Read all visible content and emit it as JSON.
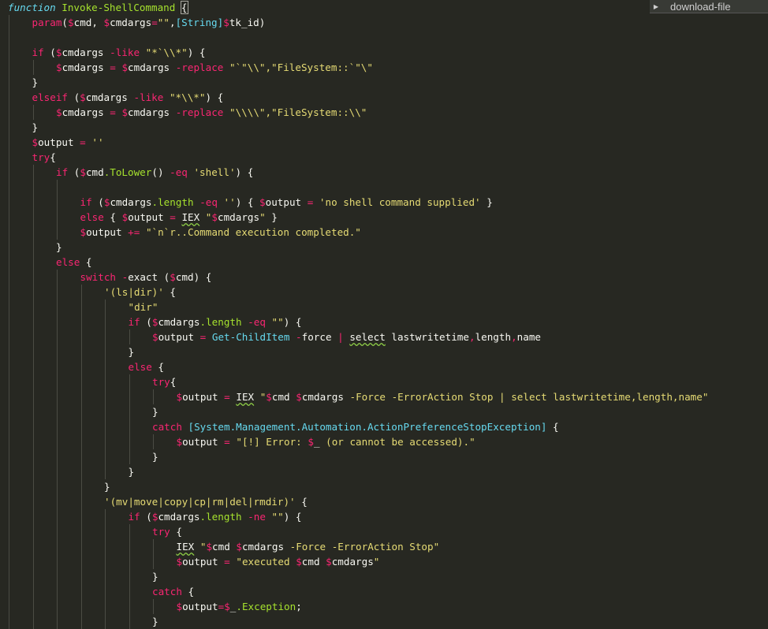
{
  "editor": {
    "theme": {
      "background": "#272822",
      "keyword": "#f92672",
      "function": "#a6e22e",
      "string": "#e6db74",
      "type": "#66d9ef",
      "text": "#f8f8f2",
      "indent_guide": "#4b4c44"
    },
    "code_lines": [
      {
        "indent": 0,
        "tokens": [
          {
            "t": "function",
            "c": "kw-it"
          },
          {
            "t": " ",
            "c": "plain"
          },
          {
            "t": "Invoke-ShellCommand",
            "c": "fn"
          },
          {
            "t": " ",
            "c": "plain"
          },
          {
            "t": "{",
            "c": "plain",
            "hl": true
          }
        ]
      },
      {
        "indent": 1,
        "tokens": [
          {
            "t": "param",
            "c": "kw"
          },
          {
            "t": "(",
            "c": "plain"
          },
          {
            "t": "$",
            "c": "dollar"
          },
          {
            "t": "cmd, ",
            "c": "var"
          },
          {
            "t": "$",
            "c": "dollar"
          },
          {
            "t": "cmdargs",
            "c": "var"
          },
          {
            "t": "=",
            "c": "op"
          },
          {
            "t": "\"\"",
            "c": "str"
          },
          {
            "t": ",",
            "c": "plain"
          },
          {
            "t": "[String]",
            "c": "type"
          },
          {
            "t": "$",
            "c": "dollar"
          },
          {
            "t": "tk_id)",
            "c": "var"
          }
        ]
      },
      {
        "indent": 1,
        "tokens": []
      },
      {
        "indent": 1,
        "tokens": [
          {
            "t": "if",
            "c": "kw"
          },
          {
            "t": " (",
            "c": "plain"
          },
          {
            "t": "$",
            "c": "dollar"
          },
          {
            "t": "cmdargs ",
            "c": "var"
          },
          {
            "t": "-like",
            "c": "op"
          },
          {
            "t": " ",
            "c": "plain"
          },
          {
            "t": "\"*`\\\\*\"",
            "c": "str"
          },
          {
            "t": ") {",
            "c": "plain"
          }
        ]
      },
      {
        "indent": 2,
        "tokens": [
          {
            "t": "$",
            "c": "dollar"
          },
          {
            "t": "cmdargs ",
            "c": "var"
          },
          {
            "t": "=",
            "c": "op"
          },
          {
            "t": " ",
            "c": "plain"
          },
          {
            "t": "$",
            "c": "dollar"
          },
          {
            "t": "cmdargs ",
            "c": "var"
          },
          {
            "t": "-replace",
            "c": "op"
          },
          {
            "t": " ",
            "c": "plain"
          },
          {
            "t": "\"`\"\\\\\",\"FileSystem::`\"\\\"",
            "c": "str"
          }
        ]
      },
      {
        "indent": 1,
        "tokens": [
          {
            "t": "}",
            "c": "plain"
          }
        ]
      },
      {
        "indent": 1,
        "tokens": [
          {
            "t": "elseif",
            "c": "kw"
          },
          {
            "t": " (",
            "c": "plain"
          },
          {
            "t": "$",
            "c": "dollar"
          },
          {
            "t": "cmdargs ",
            "c": "var"
          },
          {
            "t": "-like",
            "c": "op"
          },
          {
            "t": " ",
            "c": "plain"
          },
          {
            "t": "\"*\\\\*\"",
            "c": "str"
          },
          {
            "t": ") {",
            "c": "plain"
          }
        ]
      },
      {
        "indent": 2,
        "tokens": [
          {
            "t": "$",
            "c": "dollar"
          },
          {
            "t": "cmdargs ",
            "c": "var"
          },
          {
            "t": "=",
            "c": "op"
          },
          {
            "t": " ",
            "c": "plain"
          },
          {
            "t": "$",
            "c": "dollar"
          },
          {
            "t": "cmdargs ",
            "c": "var"
          },
          {
            "t": "-replace",
            "c": "op"
          },
          {
            "t": " ",
            "c": "plain"
          },
          {
            "t": "\"\\\\\\\\\",\"FileSystem::\\\\\"",
            "c": "str"
          }
        ]
      },
      {
        "indent": 1,
        "tokens": [
          {
            "t": "}",
            "c": "plain"
          }
        ]
      },
      {
        "indent": 1,
        "tokens": [
          {
            "t": "$",
            "c": "dollar"
          },
          {
            "t": "output ",
            "c": "var"
          },
          {
            "t": "=",
            "c": "op"
          },
          {
            "t": " ",
            "c": "plain"
          },
          {
            "t": "''",
            "c": "str"
          }
        ]
      },
      {
        "indent": 1,
        "tokens": [
          {
            "t": "try",
            "c": "kw"
          },
          {
            "t": "{",
            "c": "plain"
          }
        ]
      },
      {
        "indent": 2,
        "tokens": [
          {
            "t": "if",
            "c": "kw"
          },
          {
            "t": " (",
            "c": "plain"
          },
          {
            "t": "$",
            "c": "dollar"
          },
          {
            "t": "cmd",
            "c": "var"
          },
          {
            "t": ".ToLower",
            "c": "fn"
          },
          {
            "t": "() ",
            "c": "plain"
          },
          {
            "t": "-eq",
            "c": "op"
          },
          {
            "t": " ",
            "c": "plain"
          },
          {
            "t": "'shell'",
            "c": "str"
          },
          {
            "t": ") {",
            "c": "plain"
          }
        ]
      },
      {
        "indent": 3,
        "tokens": []
      },
      {
        "indent": 3,
        "tokens": [
          {
            "t": "if",
            "c": "kw"
          },
          {
            "t": " (",
            "c": "plain"
          },
          {
            "t": "$",
            "c": "dollar"
          },
          {
            "t": "cmdargs",
            "c": "var"
          },
          {
            "t": ".length",
            "c": "fn"
          },
          {
            "t": " ",
            "c": "plain"
          },
          {
            "t": "-eq",
            "c": "op"
          },
          {
            "t": " ",
            "c": "plain"
          },
          {
            "t": "''",
            "c": "str"
          },
          {
            "t": ") { ",
            "c": "plain"
          },
          {
            "t": "$",
            "c": "dollar"
          },
          {
            "t": "output ",
            "c": "var"
          },
          {
            "t": "=",
            "c": "op"
          },
          {
            "t": " ",
            "c": "plain"
          },
          {
            "t": "'no shell command supplied'",
            "c": "str"
          },
          {
            "t": " }",
            "c": "plain"
          }
        ]
      },
      {
        "indent": 3,
        "tokens": [
          {
            "t": "else",
            "c": "kw"
          },
          {
            "t": " { ",
            "c": "plain"
          },
          {
            "t": "$",
            "c": "dollar"
          },
          {
            "t": "output ",
            "c": "var"
          },
          {
            "t": "=",
            "c": "op"
          },
          {
            "t": " ",
            "c": "plain"
          },
          {
            "t": "IEX",
            "c": "plain",
            "sq": true
          },
          {
            "t": " ",
            "c": "plain"
          },
          {
            "t": "\"",
            "c": "str"
          },
          {
            "t": "$",
            "c": "dollar"
          },
          {
            "t": "cmdargs",
            "c": "var"
          },
          {
            "t": "\"",
            "c": "str"
          },
          {
            "t": " }",
            "c": "plain"
          }
        ]
      },
      {
        "indent": 3,
        "tokens": [
          {
            "t": "$",
            "c": "dollar"
          },
          {
            "t": "output ",
            "c": "var"
          },
          {
            "t": "+=",
            "c": "op"
          },
          {
            "t": " ",
            "c": "plain"
          },
          {
            "t": "\"`n`r..Command execution completed.\"",
            "c": "str"
          }
        ]
      },
      {
        "indent": 2,
        "tokens": [
          {
            "t": "}",
            "c": "plain"
          }
        ]
      },
      {
        "indent": 2,
        "tokens": [
          {
            "t": "else",
            "c": "kw"
          },
          {
            "t": " {",
            "c": "plain"
          }
        ]
      },
      {
        "indent": 3,
        "tokens": [
          {
            "t": "switch",
            "c": "kw"
          },
          {
            "t": " ",
            "c": "plain"
          },
          {
            "t": "-",
            "c": "op"
          },
          {
            "t": "exact (",
            "c": "plain"
          },
          {
            "t": "$",
            "c": "dollar"
          },
          {
            "t": "cmd) {",
            "c": "var"
          }
        ]
      },
      {
        "indent": 4,
        "tokens": [
          {
            "t": "'(ls|dir)'",
            "c": "str"
          },
          {
            "t": " {",
            "c": "plain"
          }
        ]
      },
      {
        "indent": 5,
        "tokens": [
          {
            "t": "\"dir\"",
            "c": "str"
          }
        ]
      },
      {
        "indent": 5,
        "tokens": [
          {
            "t": "if",
            "c": "kw"
          },
          {
            "t": " (",
            "c": "plain"
          },
          {
            "t": "$",
            "c": "dollar"
          },
          {
            "t": "cmdargs",
            "c": "var"
          },
          {
            "t": ".length",
            "c": "fn"
          },
          {
            "t": " ",
            "c": "plain"
          },
          {
            "t": "-eq",
            "c": "op"
          },
          {
            "t": " ",
            "c": "plain"
          },
          {
            "t": "\"\"",
            "c": "str"
          },
          {
            "t": ") {",
            "c": "plain"
          }
        ]
      },
      {
        "indent": 6,
        "tokens": [
          {
            "t": "$",
            "c": "dollar"
          },
          {
            "t": "output ",
            "c": "var"
          },
          {
            "t": "=",
            "c": "op"
          },
          {
            "t": " ",
            "c": "plain"
          },
          {
            "t": "Get-ChildItem",
            "c": "type"
          },
          {
            "t": " ",
            "c": "plain"
          },
          {
            "t": "-",
            "c": "op"
          },
          {
            "t": "force ",
            "c": "plain"
          },
          {
            "t": "|",
            "c": "op"
          },
          {
            "t": " ",
            "c": "plain"
          },
          {
            "t": "select",
            "c": "plain",
            "sq": true
          },
          {
            "t": " lastwritetime",
            "c": "plain"
          },
          {
            "t": ",",
            "c": "op"
          },
          {
            "t": "length",
            "c": "plain"
          },
          {
            "t": ",",
            "c": "op"
          },
          {
            "t": "name",
            "c": "plain"
          }
        ]
      },
      {
        "indent": 5,
        "tokens": [
          {
            "t": "}",
            "c": "plain"
          }
        ]
      },
      {
        "indent": 5,
        "tokens": [
          {
            "t": "else",
            "c": "kw"
          },
          {
            "t": " {",
            "c": "plain"
          }
        ]
      },
      {
        "indent": 6,
        "tokens": [
          {
            "t": "try",
            "c": "kw"
          },
          {
            "t": "{",
            "c": "plain"
          }
        ]
      },
      {
        "indent": 7,
        "tokens": [
          {
            "t": "$",
            "c": "dollar"
          },
          {
            "t": "output ",
            "c": "var"
          },
          {
            "t": "=",
            "c": "op"
          },
          {
            "t": " ",
            "c": "plain"
          },
          {
            "t": "IEX",
            "c": "plain",
            "sq": true
          },
          {
            "t": " ",
            "c": "plain"
          },
          {
            "t": "\"",
            "c": "str"
          },
          {
            "t": "$",
            "c": "dollar"
          },
          {
            "t": "cmd ",
            "c": "var"
          },
          {
            "t": "$",
            "c": "dollar"
          },
          {
            "t": "cmdargs",
            "c": "var"
          },
          {
            "t": " -Force -ErrorAction Stop | select lastwritetime,length,name\"",
            "c": "str"
          }
        ]
      },
      {
        "indent": 6,
        "tokens": [
          {
            "t": "}",
            "c": "plain"
          }
        ]
      },
      {
        "indent": 6,
        "tokens": [
          {
            "t": "catch",
            "c": "kw"
          },
          {
            "t": " ",
            "c": "plain"
          },
          {
            "t": "[System.Management.Automation.ActionPreferenceStopException]",
            "c": "type"
          },
          {
            "t": " {",
            "c": "plain"
          }
        ]
      },
      {
        "indent": 7,
        "tokens": [
          {
            "t": "$",
            "c": "dollar"
          },
          {
            "t": "output ",
            "c": "var"
          },
          {
            "t": "=",
            "c": "op"
          },
          {
            "t": " ",
            "c": "plain"
          },
          {
            "t": "\"[!] Error: ",
            "c": "str"
          },
          {
            "t": "$",
            "c": "dollar"
          },
          {
            "t": "_",
            "c": "var"
          },
          {
            "t": " (or cannot be accessed).\"",
            "c": "str"
          }
        ]
      },
      {
        "indent": 6,
        "tokens": [
          {
            "t": "}",
            "c": "plain"
          }
        ]
      },
      {
        "indent": 5,
        "tokens": [
          {
            "t": "}",
            "c": "plain"
          }
        ]
      },
      {
        "indent": 4,
        "tokens": [
          {
            "t": "}",
            "c": "plain"
          }
        ]
      },
      {
        "indent": 4,
        "tokens": [
          {
            "t": "'(mv|move|copy|cp|rm|del|rmdir)'",
            "c": "str"
          },
          {
            "t": " {",
            "c": "plain"
          }
        ]
      },
      {
        "indent": 5,
        "tokens": [
          {
            "t": "if",
            "c": "kw"
          },
          {
            "t": " (",
            "c": "plain"
          },
          {
            "t": "$",
            "c": "dollar"
          },
          {
            "t": "cmdargs",
            "c": "var"
          },
          {
            "t": ".length",
            "c": "fn"
          },
          {
            "t": " ",
            "c": "plain"
          },
          {
            "t": "-ne",
            "c": "op"
          },
          {
            "t": " ",
            "c": "plain"
          },
          {
            "t": "\"\"",
            "c": "str"
          },
          {
            "t": ") {",
            "c": "plain"
          }
        ]
      },
      {
        "indent": 6,
        "tokens": [
          {
            "t": "try",
            "c": "kw"
          },
          {
            "t": " {",
            "c": "plain"
          }
        ]
      },
      {
        "indent": 7,
        "tokens": [
          {
            "t": "IEX",
            "c": "plain",
            "sq": true
          },
          {
            "t": " ",
            "c": "plain"
          },
          {
            "t": "\"",
            "c": "str"
          },
          {
            "t": "$",
            "c": "dollar"
          },
          {
            "t": "cmd ",
            "c": "var"
          },
          {
            "t": "$",
            "c": "dollar"
          },
          {
            "t": "cmdargs",
            "c": "var"
          },
          {
            "t": " -Force -ErrorAction Stop\"",
            "c": "str"
          }
        ]
      },
      {
        "indent": 7,
        "tokens": [
          {
            "t": "$",
            "c": "dollar"
          },
          {
            "t": "output ",
            "c": "var"
          },
          {
            "t": "=",
            "c": "op"
          },
          {
            "t": " ",
            "c": "plain"
          },
          {
            "t": "\"executed ",
            "c": "str"
          },
          {
            "t": "$",
            "c": "dollar"
          },
          {
            "t": "cmd ",
            "c": "var"
          },
          {
            "t": "$",
            "c": "dollar"
          },
          {
            "t": "cmdargs",
            "c": "var"
          },
          {
            "t": "\"",
            "c": "str"
          }
        ]
      },
      {
        "indent": 6,
        "tokens": [
          {
            "t": "}",
            "c": "plain"
          }
        ]
      },
      {
        "indent": 6,
        "tokens": [
          {
            "t": "catch",
            "c": "kw"
          },
          {
            "t": " {",
            "c": "plain"
          }
        ]
      },
      {
        "indent": 7,
        "tokens": [
          {
            "t": "$",
            "c": "dollar"
          },
          {
            "t": "output",
            "c": "var"
          },
          {
            "t": "=",
            "c": "op"
          },
          {
            "t": "$",
            "c": "dollar"
          },
          {
            "t": "_",
            "c": "var"
          },
          {
            "t": ".Exception",
            "c": "fn"
          },
          {
            "t": ";",
            "c": "plain"
          }
        ]
      },
      {
        "indent": 6,
        "tokens": [
          {
            "t": "}",
            "c": "plain"
          }
        ]
      }
    ]
  },
  "minimap": {
    "toggle_icon": "triangle-right-icon",
    "toggle_glyph": "▶",
    "label": "download-file"
  }
}
